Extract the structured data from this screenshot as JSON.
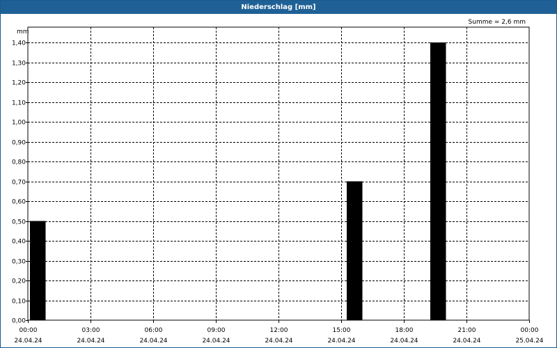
{
  "chart_data": {
    "type": "bar",
    "title": "Niederschlag [mm]",
    "ylabel": "mm",
    "summary": "Summe = 2,6 mm",
    "ylim": [
      0,
      1.45
    ],
    "xlim_hours": [
      0,
      24
    ],
    "y_ticks": [
      "0,00",
      "0,10",
      "0,20",
      "0,30",
      "0,40",
      "0,50",
      "0,60",
      "0,70",
      "0,80",
      "0,90",
      "1,00",
      "1,10",
      "1,20",
      "1,30",
      "1,40"
    ],
    "x_ticks": [
      {
        "time": "00:00",
        "date": "24.04.24"
      },
      {
        "time": "03:00",
        "date": "24.04.24"
      },
      {
        "time": "06:00",
        "date": "24.04.24"
      },
      {
        "time": "09:00",
        "date": "24.04.24"
      },
      {
        "time": "12:00",
        "date": "24.04.24"
      },
      {
        "time": "15:00",
        "date": "24.04.24"
      },
      {
        "time": "18:00",
        "date": "24.04.24"
      },
      {
        "time": "21:00",
        "date": "24.04.24"
      },
      {
        "time": "00:00",
        "date": "25.04.24"
      }
    ],
    "bars": [
      {
        "start": "24.04.24 00:00",
        "end": "24.04.24 00:45",
        "value": 0.5
      },
      {
        "start": "24.04.24 15:10",
        "end": "24.04.24 15:55",
        "value": 0.7
      },
      {
        "start": "24.04.24 19:10",
        "end": "24.04.24 19:55",
        "value": 1.4
      }
    ],
    "grid": true,
    "bar_color": "#000000"
  }
}
